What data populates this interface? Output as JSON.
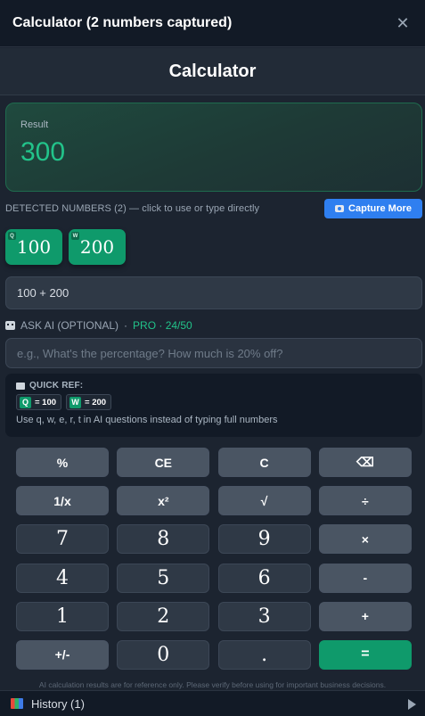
{
  "window": {
    "title": "Calculator (2 numbers captured)",
    "close_glyph": "✕"
  },
  "header": {
    "title": "Calculator"
  },
  "result": {
    "label": "Result",
    "value": "300"
  },
  "detected": {
    "label": "DETECTED NUMBERS (2) — click to use or type directly",
    "capture_label": "Capture More",
    "chips": [
      {
        "key": "Q",
        "value": "100"
      },
      {
        "key": "W",
        "value": "200"
      }
    ]
  },
  "expression": {
    "value": "100 + 200"
  },
  "ask_ai": {
    "label": "ASK AI (OPTIONAL)",
    "separator": "·",
    "pro": "PRO · 24/50",
    "placeholder": "e.g., What's the percentage? How much is 20% off?"
  },
  "quick_ref": {
    "title": "QUICK REF:",
    "tags": [
      {
        "key": "Q",
        "text": "= 100"
      },
      {
        "key": "W",
        "text": "= 200"
      }
    ],
    "hint": "Use q, w, e, r, t in AI questions instead of typing full numbers"
  },
  "keypad": {
    "rows": [
      [
        {
          "label": "%",
          "kind": "op",
          "name": "percent"
        },
        {
          "label": "CE",
          "kind": "op",
          "name": "clear-entry"
        },
        {
          "label": "C",
          "kind": "op",
          "name": "clear"
        },
        {
          "label": "⌫",
          "kind": "op",
          "name": "backspace"
        }
      ],
      [
        {
          "label": "1/x",
          "kind": "op",
          "name": "reciprocal"
        },
        {
          "label": "x²",
          "kind": "op",
          "name": "square"
        },
        {
          "label": "√",
          "kind": "op",
          "name": "sqrt"
        },
        {
          "label": "÷",
          "kind": "op",
          "name": "divide"
        }
      ],
      [
        {
          "label": "7",
          "kind": "num",
          "name": "7"
        },
        {
          "label": "8",
          "kind": "num",
          "name": "8"
        },
        {
          "label": "9",
          "kind": "num",
          "name": "9"
        },
        {
          "label": "×",
          "kind": "op",
          "name": "multiply"
        }
      ],
      [
        {
          "label": "4",
          "kind": "num",
          "name": "4"
        },
        {
          "label": "5",
          "kind": "num",
          "name": "5"
        },
        {
          "label": "6",
          "kind": "num",
          "name": "6"
        },
        {
          "label": "-",
          "kind": "op",
          "name": "subtract"
        }
      ],
      [
        {
          "label": "1",
          "kind": "num",
          "name": "1"
        },
        {
          "label": "2",
          "kind": "num",
          "name": "2"
        },
        {
          "label": "3",
          "kind": "num",
          "name": "3"
        },
        {
          "label": "+",
          "kind": "op",
          "name": "add"
        }
      ],
      [
        {
          "label": "+/-",
          "kind": "op",
          "name": "negate"
        },
        {
          "label": "0",
          "kind": "num",
          "name": "0"
        },
        {
          "label": ".",
          "kind": "num",
          "name": "decimal"
        },
        {
          "label": "=",
          "kind": "eq",
          "name": "equals"
        }
      ]
    ]
  },
  "disclaimer": "AI calculation results are for reference only. Please verify before using for important business decisions.",
  "footer": {
    "history_label": "History (1)"
  },
  "colors": {
    "accent_green": "#22c38a",
    "chip_green": "#0f9a6b",
    "capture_blue": "#2f7ff0"
  }
}
